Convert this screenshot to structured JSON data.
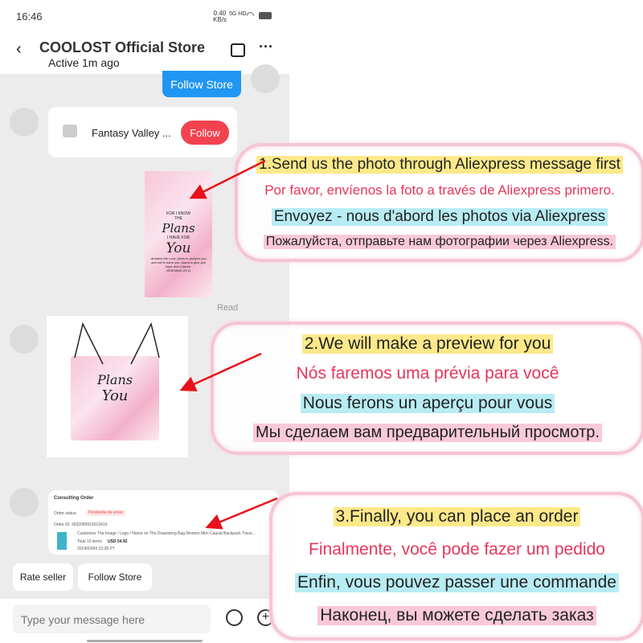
{
  "status_bar": {
    "time": "16:46",
    "speed": "0.40",
    "speed_unit": "KB/s",
    "network": "5G HD"
  },
  "header": {
    "title": "COOLOST Official Store",
    "subtitle": "Active 1m ago"
  },
  "messages": {
    "follow_store_bubble": "Follow Store",
    "store_card": {
      "name": "Fantasy Valley ...",
      "follow_label": "Follow"
    },
    "read_label": "Read",
    "order": {
      "title": "Consulting Order",
      "status_label": "Order status:",
      "status_value": "Pendiente de envío",
      "order_id": "Order ID: 3032089918319419",
      "product": "Customize The Image / Logo / Name on The Drawstring Bag Women Men Causal Backpack Trave...",
      "total_items": "Total 10 items",
      "price": "USD 54.92",
      "date": "2024/03/04 23:28 PT"
    }
  },
  "product_image": {
    "line1": "FOR I KNOW",
    "line2": "THE",
    "line3": "Plans",
    "line4": "I HAVE FOR",
    "line5": "You",
    "verse": "declares the Lord, plans to prosper you and not to harm you, plans to give you hope and a future.",
    "ref": "JEREMIAH 29:11"
  },
  "quick_actions": [
    "Rate seller",
    "Follow Store"
  ],
  "composer": {
    "placeholder": "Type your message here"
  },
  "instructions": [
    [
      "1.Send us the photo through Aliexpress message first",
      "Por favor, envíenos la foto a través de Aliexpress primero.",
      "Envoyez - nous d'abord les photos via Aliexpress",
      "Пожалуйста, отправьте нам фотографии через Aliexpress."
    ],
    [
      "2.We will make a preview for you",
      "Nós faremos uma prévia para você",
      "Nous ferons un aperçu pour vous",
      "Мы сделаем вам предварительный просмотр."
    ],
    [
      "3.Finally, you can place an order",
      "Finalmente, você pode fazer um pedido",
      "Enfin, vous pouvez passer une commande",
      "Наконец, вы можете сделать заказ"
    ]
  ],
  "colors": {
    "accent_blue": "#2196f3",
    "follow_red": "#f2424f",
    "arrow_red": "#e8101a",
    "box_pink": "#f6c5d3"
  }
}
